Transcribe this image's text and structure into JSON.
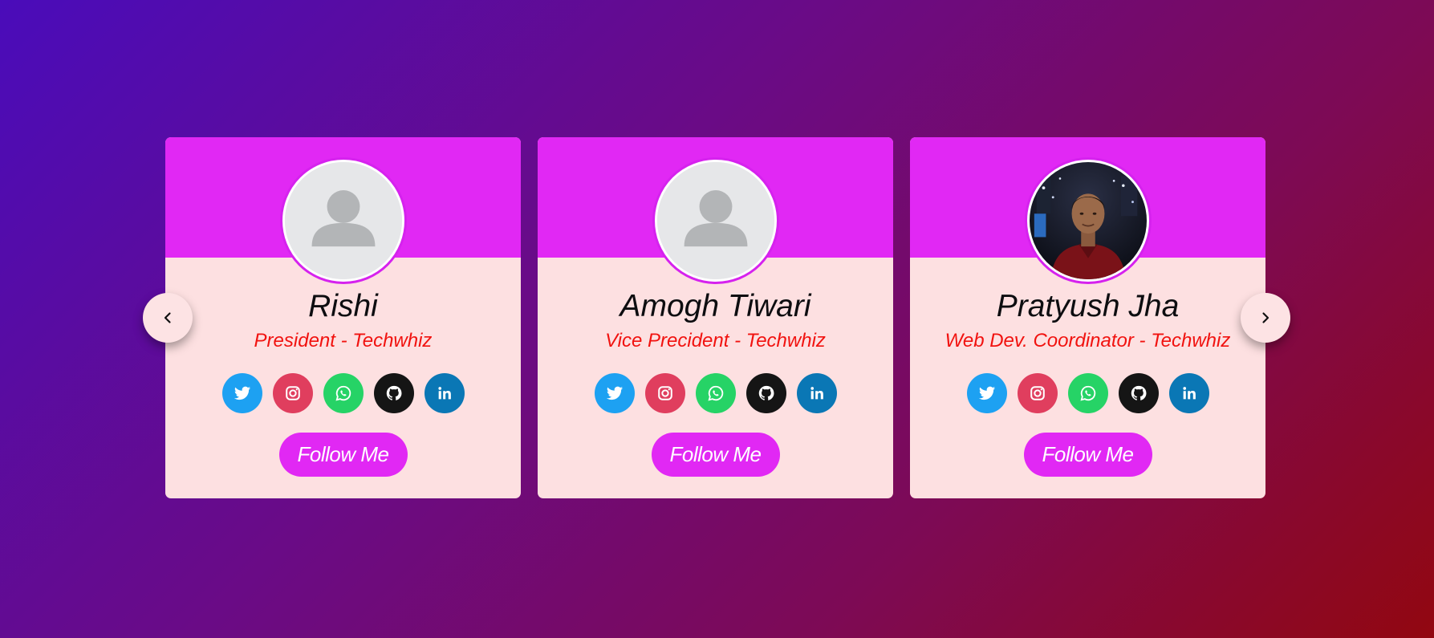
{
  "carousel": {
    "prev_icon": "chevron-left-icon",
    "next_icon": "chevron-right-icon"
  },
  "colors": {
    "card_header": "#e128f4",
    "card_body": "#fde0e1",
    "role_text": "#f1120f",
    "follow_button": "#e128f4",
    "twitter": "#1da1f2",
    "instagram": "#e03e5e",
    "whatsapp": "#26d366",
    "github": "#151515",
    "linkedin": "#0a77b5"
  },
  "cards": [
    {
      "name": "Rishi",
      "role": "President - Techwhiz",
      "avatar": "default-user-avatar",
      "follow_label": "Follow Me",
      "socials": [
        "twitter-icon",
        "instagram-icon",
        "whatsapp-icon",
        "github-icon",
        "linkedin-icon"
      ]
    },
    {
      "name": "Amogh Tiwari",
      "role": "Vice Precident - Techwhiz",
      "avatar": "default-user-avatar",
      "follow_label": "Follow Me",
      "socials": [
        "twitter-icon",
        "instagram-icon",
        "whatsapp-icon",
        "github-icon",
        "linkedin-icon"
      ]
    },
    {
      "name": "Pratyush Jha",
      "role": "Web Dev. Coordinator - Techwhiz",
      "avatar": "profile-photo",
      "follow_label": "Follow Me",
      "socials": [
        "twitter-icon",
        "instagram-icon",
        "whatsapp-icon",
        "github-icon",
        "linkedin-icon"
      ]
    }
  ]
}
